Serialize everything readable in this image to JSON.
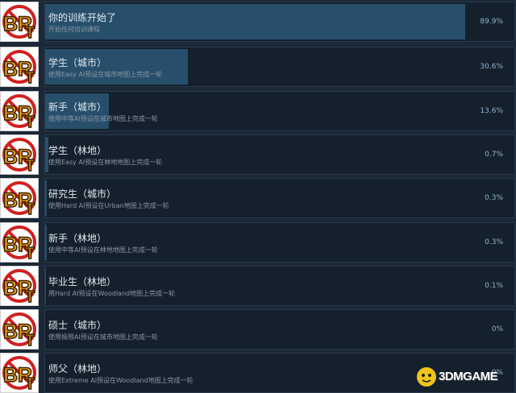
{
  "achievements": [
    {
      "title": "你的训练开始了",
      "desc": "开始任何培训课程",
      "percent": "89.9%",
      "fill": 0.899
    },
    {
      "title": "学生（城市）",
      "desc": "使用Easy AI预设在城市地图上完成一轮",
      "percent": "30.6%",
      "fill": 0.306
    },
    {
      "title": "新手（城市）",
      "desc": "使用中等AI预设在城市地图上完成一轮",
      "percent": "13.6%",
      "fill": 0.136
    },
    {
      "title": "学生（林地）",
      "desc": "使用Easy AI预设在林地地图上完成一轮",
      "percent": "0.7%",
      "fill": 0.007
    },
    {
      "title": "研究生（城市）",
      "desc": "使用Hard AI预设在Urban地图上完成一轮",
      "percent": "0.3%",
      "fill": 0.003
    },
    {
      "title": "新手（林地）",
      "desc": "使用中等AI预设在林地地图上完成一轮",
      "percent": "0.3%",
      "fill": 0.003
    },
    {
      "title": "毕业生（林地）",
      "desc": "用Hard AI预设在Woodland地图上完成一轮",
      "percent": "0.1%",
      "fill": 0.001
    },
    {
      "title": "硕士（城市）",
      "desc": "使用极限AI预设在城市地图上完成一轮",
      "percent": "0%",
      "fill": 0
    },
    {
      "title": "师父（林地）",
      "desc": "使用Extreme AI预设在Woodland地图上完成一轮",
      "percent": "0%",
      "fill": 0
    }
  ],
  "icon_text": "BRT",
  "watermark": {
    "text": "3DMGAME"
  },
  "colors": {
    "background": "#1b2838",
    "progress": "#274f6b",
    "percent_text": "#8fb4cc",
    "icon_orange": "#f0a020",
    "icon_red": "#d02020"
  }
}
